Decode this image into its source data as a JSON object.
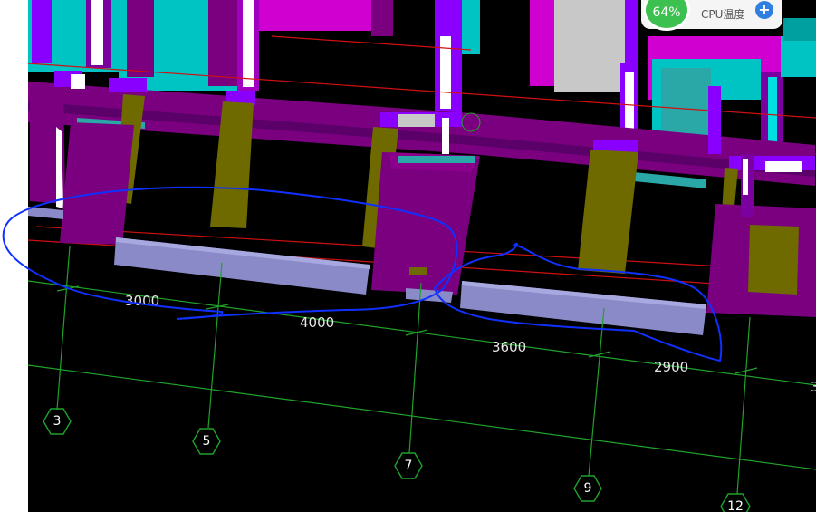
{
  "cad": {
    "dimensions": [
      {
        "id": "3-5",
        "text": "3000"
      },
      {
        "id": "5-7",
        "text": "4000"
      },
      {
        "id": "7-9",
        "text": "3600"
      },
      {
        "id": "9-12",
        "text": "2900"
      }
    ],
    "axes": [
      {
        "id": "3",
        "text": "3"
      },
      {
        "id": "5",
        "text": "5"
      },
      {
        "id": "7",
        "text": "7"
      },
      {
        "id": "9",
        "text": "9"
      },
      {
        "id": "12",
        "text": "12"
      }
    ],
    "colors": {
      "background": "#000000",
      "grid": "#1fa32a",
      "red_lines": "#d01010",
      "beam": "#7a0080",
      "column_olive": "#6e6a00",
      "cyan": "#00c4c4",
      "magenta": "#d000d0",
      "violet": "#8a00ff",
      "slab_lavender": "#8a8ac8",
      "annotation": "#1030ff"
    }
  },
  "cpu_widget": {
    "usage": "64%",
    "label": "CPU温度",
    "plus_icon": "plus-icon",
    "colors": {
      "gauge": "#3cc04f",
      "plus": "#2f7fe0"
    }
  }
}
